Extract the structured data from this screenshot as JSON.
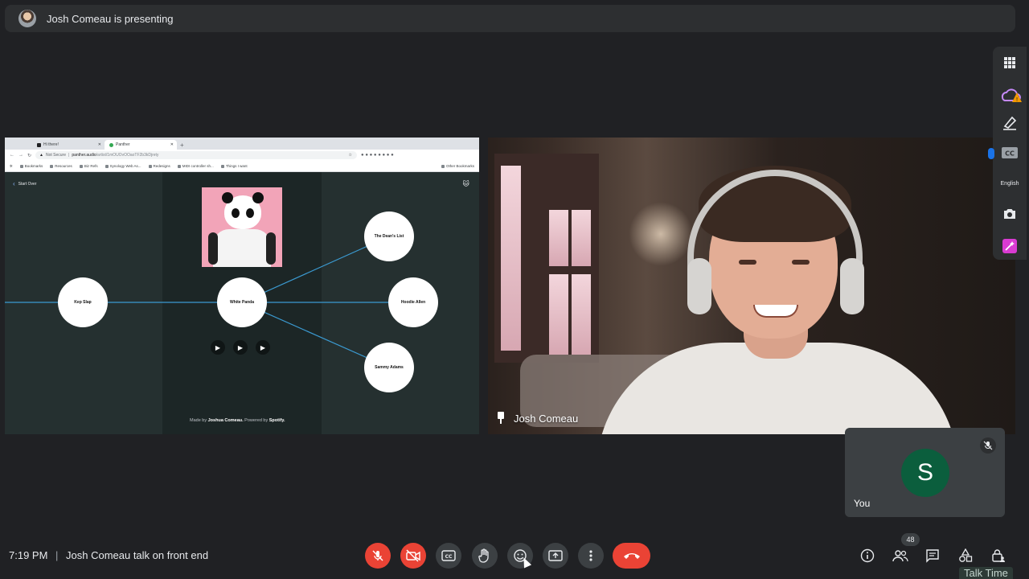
{
  "top_bar": {
    "presenting_text": "Josh Comeau is presenting"
  },
  "browser": {
    "tabs": [
      {
        "label": "Hi there!"
      },
      {
        "label": "Panther"
      }
    ],
    "new_tab": "+",
    "not_secure": "Not Secure",
    "url_host": "panther.audio",
    "url_path": "/artist/1mOUOvOOaoTF2b3kDjrety",
    "bookmarks": [
      "Bookmarks",
      "Resources",
      "Biz Refs",
      "Synology Web As...",
      "Redesigns",
      "MIDI controller sh...",
      "Things I want"
    ],
    "other_bookmarks": "Other Bookmarks"
  },
  "panther": {
    "start_over": "Start Over",
    "nodes": {
      "kep_slap": "Kep Slap",
      "white_panda": "White Panda",
      "deans_list": "The Dean's List",
      "hoodie_allen": "Hoodie Allen",
      "sammy_adams": "Sammy Adams"
    },
    "made_by_prefix": "Made by ",
    "made_by_name": "Joshua Comeau.",
    "powered_by": " Powered by ",
    "spotify": "Spotify."
  },
  "presenter": {
    "name": "Josh Comeau"
  },
  "self_tile": {
    "initial": "S",
    "label": "You"
  },
  "side_panel": {
    "language": "English"
  },
  "bottom": {
    "time": "7:19 PM",
    "separator": "|",
    "meeting_title": "Josh Comeau talk on front end",
    "participants_count": "48",
    "talk_time": "Talk Time"
  }
}
